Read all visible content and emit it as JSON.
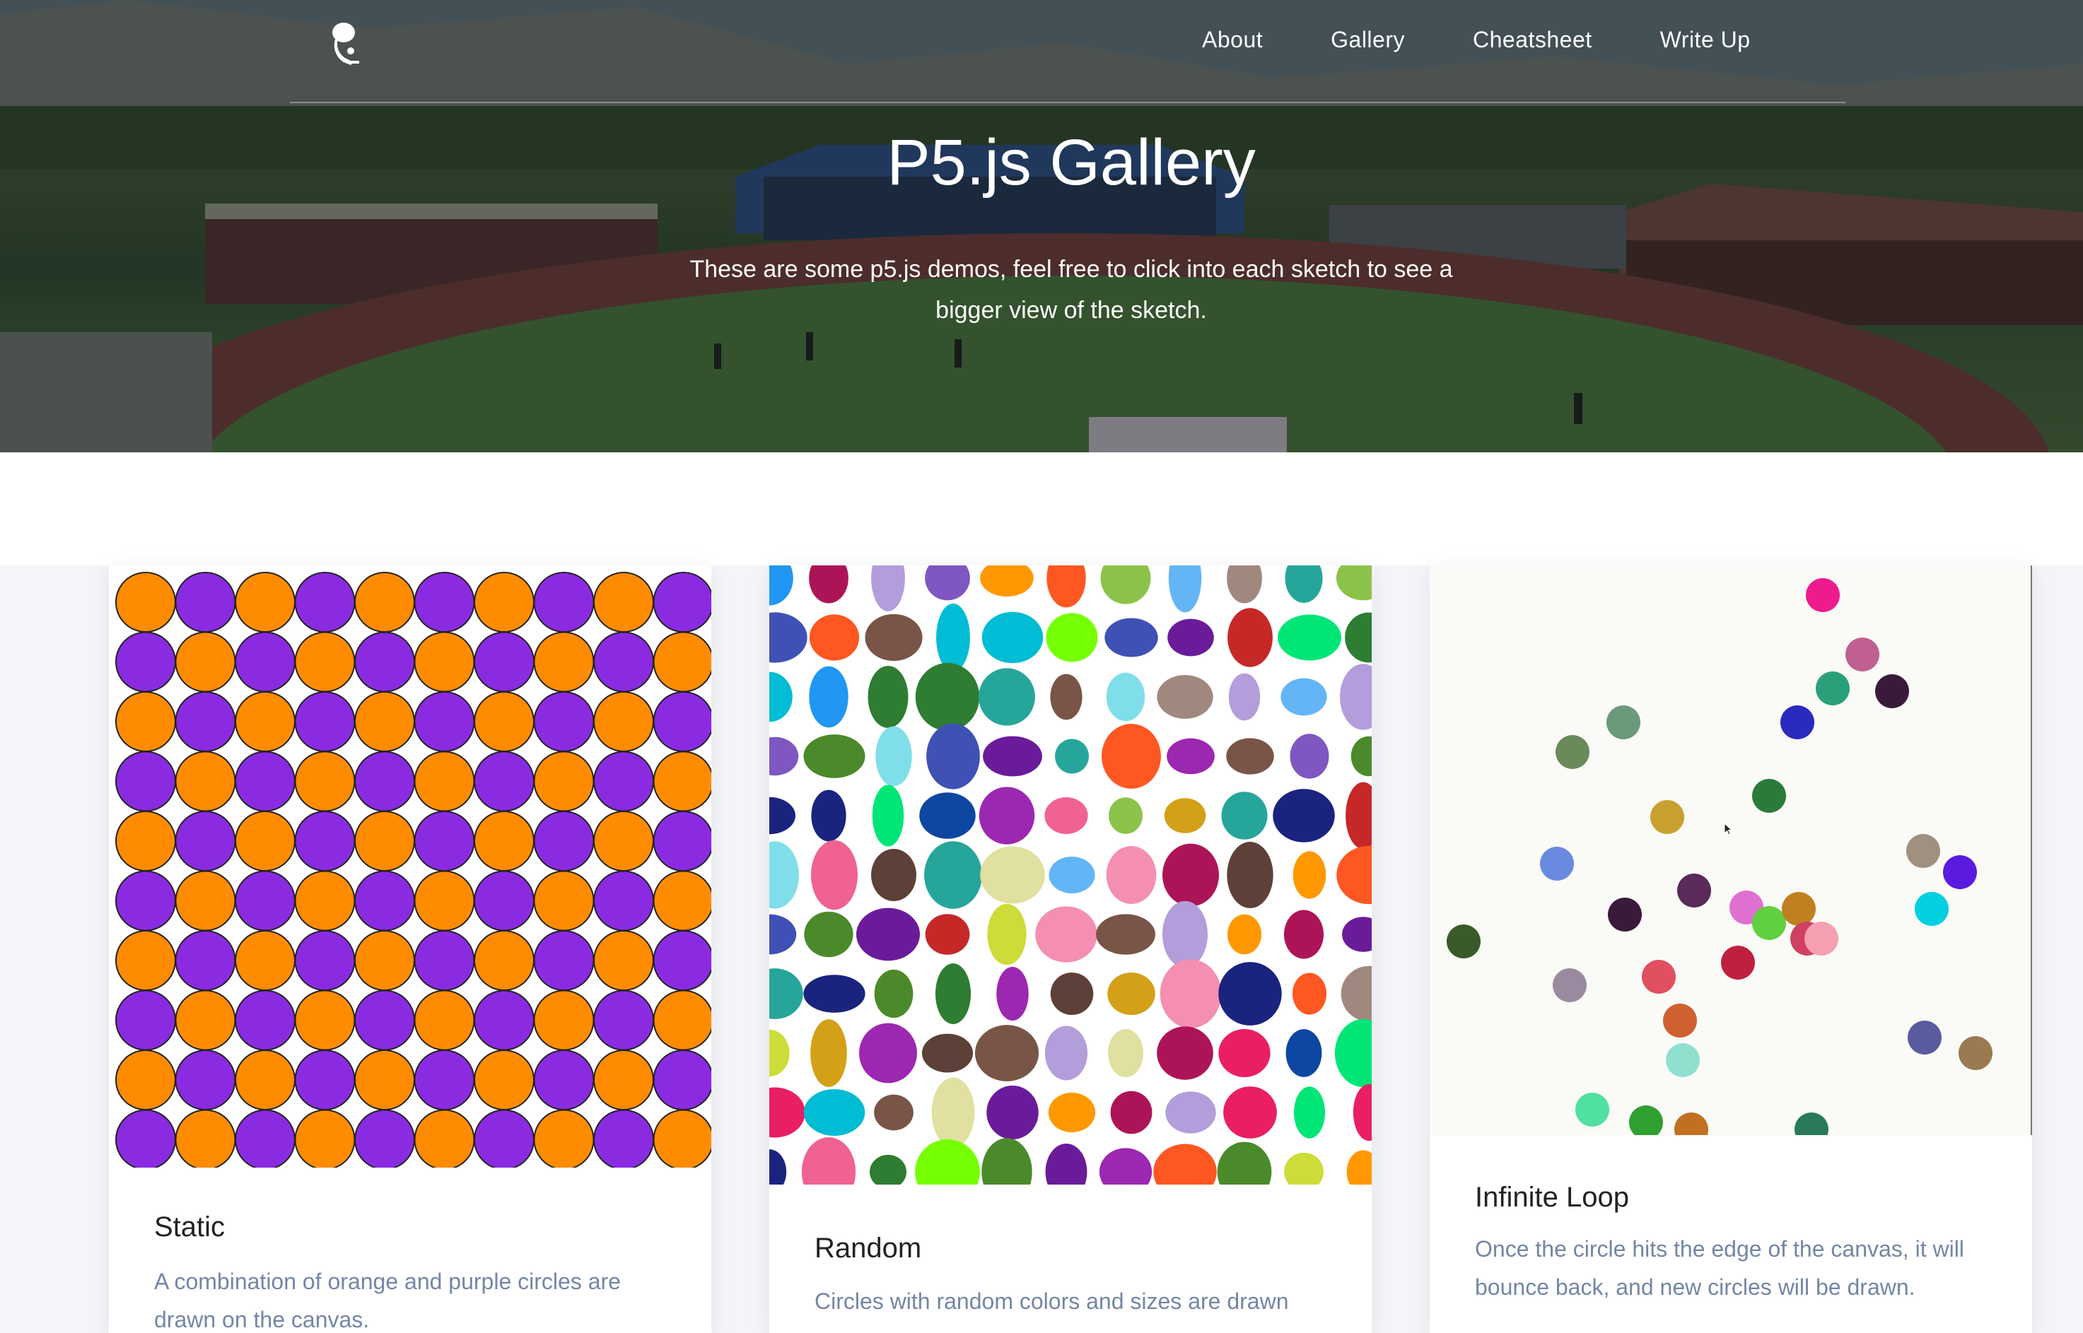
{
  "nav": {
    "logo": "p5-logo-icon",
    "items": [
      {
        "label": "About"
      },
      {
        "label": "Gallery"
      },
      {
        "label": "Cheatsheet"
      },
      {
        "label": "Write Up"
      }
    ]
  },
  "hero": {
    "title": "P5.js Gallery",
    "subtitle": "These are some p5.js demos, feel free to click into each sketch to see a bigger view of the sketch.",
    "background_image": "school-sports-field-photo"
  },
  "cards": [
    {
      "title": "Static",
      "description": "A combination of orange and purple circles are drawn on the canvas.",
      "sketch": "checker-circles",
      "colors": {
        "a": "#ff8c00",
        "b": "#8a2be2"
      }
    },
    {
      "title": "Random",
      "description": "Circles with random colors and sizes are drawn",
      "sketch": "random-ellipses"
    },
    {
      "title": "Infinite Loop",
      "description": "Once the circle hits the edge of the canvas, it will bounce back, and new circles will be drawn.",
      "sketch": "bouncing-circles"
    }
  ],
  "colors": {
    "text_dark": "#222222",
    "text_muted": "#7486a6",
    "gallery_bg": "#f4f5f9"
  }
}
